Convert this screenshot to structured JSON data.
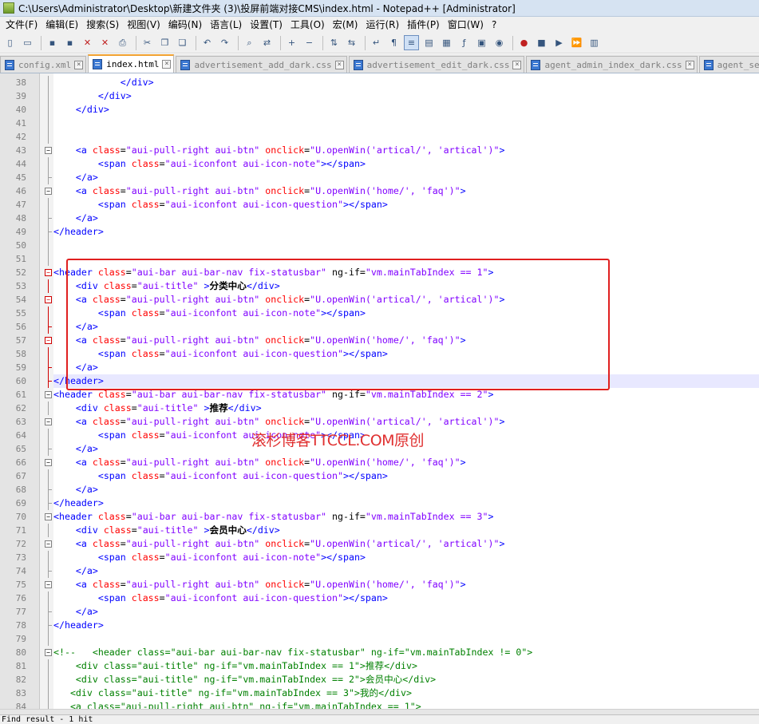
{
  "window": {
    "title": "C:\\Users\\Administrator\\Desktop\\新建文件夹 (3)\\投屏前端对接CMS\\index.html - Notepad++ [Administrator]"
  },
  "menu": [
    "文件(F)",
    "编辑(E)",
    "搜索(S)",
    "视图(V)",
    "编码(N)",
    "语言(L)",
    "设置(T)",
    "工具(O)",
    "宏(M)",
    "运行(R)",
    "插件(P)",
    "窗口(W)",
    "?"
  ],
  "toolbar": {
    "icons": [
      "new-file-icon",
      "open-file-icon",
      "save-icon",
      "save-all-icon",
      "close-icon",
      "close-all-icon",
      "print-icon",
      "cut-icon",
      "copy-icon",
      "paste-icon",
      "undo-icon",
      "redo-icon",
      "find-icon",
      "replace-icon",
      "zoom-in-icon",
      "zoom-out-icon",
      "sync-vertical-icon",
      "sync-horizontal-icon",
      "word-wrap-icon",
      "show-all-chars-icon",
      "indent-guide-icon",
      "user-language-icon",
      "doc-map-icon",
      "function-list-icon",
      "folder-workspace-icon",
      "monitoring-icon",
      "record-macro-icon",
      "stop-record-icon",
      "play-macro-icon",
      "run-macro-multiple-icon",
      "save-macro-icon"
    ],
    "active_icon": "indent-guide-icon"
  },
  "tabs": [
    {
      "label": "config.xml",
      "active": false
    },
    {
      "label": "index.html",
      "active": true
    },
    {
      "label": "advertisement_add_dark.css",
      "active": false
    },
    {
      "label": "advertisement_edit_dark.css",
      "active": false
    },
    {
      "label": "agent_admin_index_dark.css",
      "active": false
    },
    {
      "label": "agent_search.css",
      "active": false
    }
  ],
  "editor": {
    "current_line": 60,
    "lines": [
      {
        "n": 38,
        "fold": "line",
        "t": [
          [
            "tag",
            "            </div>"
          ]
        ]
      },
      {
        "n": 39,
        "fold": "line",
        "t": [
          [
            "tag",
            "        </div>"
          ]
        ]
      },
      {
        "n": 40,
        "fold": "line",
        "t": [
          [
            "tag",
            "    </div>"
          ]
        ]
      },
      {
        "n": 41,
        "fold": "line",
        "t": []
      },
      {
        "n": 42,
        "fold": "line",
        "t": []
      },
      {
        "n": 43,
        "fold": "box",
        "t": [
          [
            "plain",
            "    "
          ],
          [
            "tag",
            "<a "
          ],
          [
            "attr",
            "class"
          ],
          [
            "op",
            "="
          ],
          [
            "str",
            "\"aui-pull-right aui-btn\""
          ],
          [
            "plain",
            " "
          ],
          [
            "attr",
            "onclick"
          ],
          [
            "op",
            "="
          ],
          [
            "str",
            "\"U.openWin('artical/', 'artical')\""
          ],
          [
            "tag",
            ">"
          ]
        ]
      },
      {
        "n": 44,
        "fold": "line",
        "t": [
          [
            "plain",
            "        "
          ],
          [
            "tag",
            "<span "
          ],
          [
            "attr",
            "class"
          ],
          [
            "op",
            "="
          ],
          [
            "str",
            "\"aui-iconfont aui-icon-note\""
          ],
          [
            "tag",
            "></span>"
          ]
        ]
      },
      {
        "n": 45,
        "fold": "end",
        "t": [
          [
            "plain",
            "    "
          ],
          [
            "tag",
            "</a>"
          ]
        ]
      },
      {
        "n": 46,
        "fold": "box",
        "t": [
          [
            "plain",
            "    "
          ],
          [
            "tag",
            "<a "
          ],
          [
            "attr",
            "class"
          ],
          [
            "op",
            "="
          ],
          [
            "str",
            "\"aui-pull-right aui-btn\""
          ],
          [
            "plain",
            " "
          ],
          [
            "attr",
            "onclick"
          ],
          [
            "op",
            "="
          ],
          [
            "str",
            "\"U.openWin('home/', 'faq')\""
          ],
          [
            "tag",
            ">"
          ]
        ]
      },
      {
        "n": 47,
        "fold": "line",
        "t": [
          [
            "plain",
            "        "
          ],
          [
            "tag",
            "<span "
          ],
          [
            "attr",
            "class"
          ],
          [
            "op",
            "="
          ],
          [
            "str",
            "\"aui-iconfont aui-icon-question\""
          ],
          [
            "tag",
            "></span>"
          ]
        ]
      },
      {
        "n": 48,
        "fold": "end",
        "t": [
          [
            "plain",
            "    "
          ],
          [
            "tag",
            "</a>"
          ]
        ]
      },
      {
        "n": 49,
        "fold": "end",
        "t": [
          [
            "tag",
            "</header>"
          ]
        ]
      },
      {
        "n": 50,
        "fold": "line",
        "t": []
      },
      {
        "n": 51,
        "fold": "line",
        "t": []
      },
      {
        "n": 52,
        "fold": "boxred",
        "t": [
          [
            "tag",
            "<header "
          ],
          [
            "attr",
            "class"
          ],
          [
            "op",
            "="
          ],
          [
            "str",
            "\"aui-bar aui-bar-nav fix-statusbar\""
          ],
          [
            "plain",
            " ng-if="
          ],
          [
            "str",
            "\"vm.mainTabIndex == 1\""
          ],
          [
            "tag",
            ">"
          ]
        ]
      },
      {
        "n": 53,
        "fold": "linered",
        "t": [
          [
            "plain",
            "    "
          ],
          [
            "tag",
            "<div "
          ],
          [
            "attr",
            "class"
          ],
          [
            "op",
            "="
          ],
          [
            "str",
            "\"aui-title\""
          ],
          [
            "plain",
            " "
          ],
          [
            "tag",
            ">"
          ],
          [
            "bold",
            "分类中心"
          ],
          [
            "tag",
            "</div>"
          ]
        ]
      },
      {
        "n": 54,
        "fold": "boxred",
        "t": [
          [
            "plain",
            "    "
          ],
          [
            "tag",
            "<a "
          ],
          [
            "attr",
            "class"
          ],
          [
            "op",
            "="
          ],
          [
            "str",
            "\"aui-pull-right aui-btn\""
          ],
          [
            "plain",
            " "
          ],
          [
            "attr",
            "onclick"
          ],
          [
            "op",
            "="
          ],
          [
            "str",
            "\"U.openWin('artical/', 'artical')\""
          ],
          [
            "tag",
            ">"
          ]
        ]
      },
      {
        "n": 55,
        "fold": "linered",
        "t": [
          [
            "plain",
            "        "
          ],
          [
            "tag",
            "<span "
          ],
          [
            "attr",
            "class"
          ],
          [
            "op",
            "="
          ],
          [
            "str",
            "\"aui-iconfont aui-icon-note\""
          ],
          [
            "tag",
            "></span>"
          ]
        ]
      },
      {
        "n": 56,
        "fold": "endred",
        "t": [
          [
            "plain",
            "    "
          ],
          [
            "tag",
            "</a>"
          ]
        ]
      },
      {
        "n": 57,
        "fold": "boxred",
        "t": [
          [
            "plain",
            "    "
          ],
          [
            "tag",
            "<a "
          ],
          [
            "attr",
            "class"
          ],
          [
            "op",
            "="
          ],
          [
            "str",
            "\"aui-pull-right aui-btn\""
          ],
          [
            "plain",
            " "
          ],
          [
            "attr",
            "onclick"
          ],
          [
            "op",
            "="
          ],
          [
            "str",
            "\"U.openWin('home/', 'faq')\""
          ],
          [
            "tag",
            ">"
          ]
        ]
      },
      {
        "n": 58,
        "fold": "linered",
        "t": [
          [
            "plain",
            "        "
          ],
          [
            "tag",
            "<span "
          ],
          [
            "attr",
            "class"
          ],
          [
            "op",
            "="
          ],
          [
            "str",
            "\"aui-iconfont aui-icon-question\""
          ],
          [
            "tag",
            "></span>"
          ]
        ]
      },
      {
        "n": 59,
        "fold": "endred",
        "t": [
          [
            "plain",
            "    "
          ],
          [
            "tag",
            "</a>"
          ]
        ]
      },
      {
        "n": 60,
        "fold": "endred",
        "t": [
          [
            "tag",
            "</header>"
          ]
        ]
      },
      {
        "n": 61,
        "fold": "box",
        "t": [
          [
            "tag",
            "<header "
          ],
          [
            "attr",
            "class"
          ],
          [
            "op",
            "="
          ],
          [
            "str",
            "\"aui-bar aui-bar-nav fix-statusbar\""
          ],
          [
            "plain",
            " ng-if="
          ],
          [
            "str",
            "\"vm.mainTabIndex == 2\""
          ],
          [
            "tag",
            ">"
          ]
        ]
      },
      {
        "n": 62,
        "fold": "line",
        "t": [
          [
            "plain",
            "    "
          ],
          [
            "tag",
            "<div "
          ],
          [
            "attr",
            "class"
          ],
          [
            "op",
            "="
          ],
          [
            "str",
            "\"aui-title\""
          ],
          [
            "plain",
            " "
          ],
          [
            "tag",
            ">"
          ],
          [
            "bold",
            "推荐"
          ],
          [
            "tag",
            "</div>"
          ]
        ]
      },
      {
        "n": 63,
        "fold": "box",
        "t": [
          [
            "plain",
            "    "
          ],
          [
            "tag",
            "<a "
          ],
          [
            "attr",
            "class"
          ],
          [
            "op",
            "="
          ],
          [
            "str",
            "\"aui-pull-right aui-btn\""
          ],
          [
            "plain",
            " "
          ],
          [
            "attr",
            "onclick"
          ],
          [
            "op",
            "="
          ],
          [
            "str",
            "\"U.openWin('artical/', 'artical')\""
          ],
          [
            "tag",
            ">"
          ]
        ]
      },
      {
        "n": 64,
        "fold": "line",
        "t": [
          [
            "plain",
            "        "
          ],
          [
            "tag",
            "<span "
          ],
          [
            "attr",
            "class"
          ],
          [
            "op",
            "="
          ],
          [
            "str",
            "\"aui-iconfont aui-icon-note\""
          ],
          [
            "tag",
            "></span>"
          ]
        ]
      },
      {
        "n": 65,
        "fold": "end",
        "t": [
          [
            "plain",
            "    "
          ],
          [
            "tag",
            "</a>"
          ]
        ]
      },
      {
        "n": 66,
        "fold": "box",
        "t": [
          [
            "plain",
            "    "
          ],
          [
            "tag",
            "<a "
          ],
          [
            "attr",
            "class"
          ],
          [
            "op",
            "="
          ],
          [
            "str",
            "\"aui-pull-right aui-btn\""
          ],
          [
            "plain",
            " "
          ],
          [
            "attr",
            "onclick"
          ],
          [
            "op",
            "="
          ],
          [
            "str",
            "\"U.openWin('home/', 'faq')\""
          ],
          [
            "tag",
            ">"
          ]
        ]
      },
      {
        "n": 67,
        "fold": "line",
        "t": [
          [
            "plain",
            "        "
          ],
          [
            "tag",
            "<span "
          ],
          [
            "attr",
            "class"
          ],
          [
            "op",
            "="
          ],
          [
            "str",
            "\"aui-iconfont aui-icon-question\""
          ],
          [
            "tag",
            "></span>"
          ]
        ]
      },
      {
        "n": 68,
        "fold": "end",
        "t": [
          [
            "plain",
            "    "
          ],
          [
            "tag",
            "</a>"
          ]
        ]
      },
      {
        "n": 69,
        "fold": "end",
        "t": [
          [
            "tag",
            "</header>"
          ]
        ]
      },
      {
        "n": 70,
        "fold": "box",
        "t": [
          [
            "tag",
            "<header "
          ],
          [
            "attr",
            "class"
          ],
          [
            "op",
            "="
          ],
          [
            "str",
            "\"aui-bar aui-bar-nav fix-statusbar\""
          ],
          [
            "plain",
            " ng-if="
          ],
          [
            "str",
            "\"vm.mainTabIndex == 3\""
          ],
          [
            "tag",
            ">"
          ]
        ]
      },
      {
        "n": 71,
        "fold": "line",
        "t": [
          [
            "plain",
            "    "
          ],
          [
            "tag",
            "<div "
          ],
          [
            "attr",
            "class"
          ],
          [
            "op",
            "="
          ],
          [
            "str",
            "\"aui-title\""
          ],
          [
            "plain",
            " "
          ],
          [
            "tag",
            ">"
          ],
          [
            "bold",
            "会员中心"
          ],
          [
            "tag",
            "</div>"
          ]
        ]
      },
      {
        "n": 72,
        "fold": "box",
        "t": [
          [
            "plain",
            "    "
          ],
          [
            "tag",
            "<a "
          ],
          [
            "attr",
            "class"
          ],
          [
            "op",
            "="
          ],
          [
            "str",
            "\"aui-pull-right aui-btn\""
          ],
          [
            "plain",
            " "
          ],
          [
            "attr",
            "onclick"
          ],
          [
            "op",
            "="
          ],
          [
            "str",
            "\"U.openWin('artical/', 'artical')\""
          ],
          [
            "tag",
            ">"
          ]
        ]
      },
      {
        "n": 73,
        "fold": "line",
        "t": [
          [
            "plain",
            "        "
          ],
          [
            "tag",
            "<span "
          ],
          [
            "attr",
            "class"
          ],
          [
            "op",
            "="
          ],
          [
            "str",
            "\"aui-iconfont aui-icon-note\""
          ],
          [
            "tag",
            "></span>"
          ]
        ]
      },
      {
        "n": 74,
        "fold": "end",
        "t": [
          [
            "plain",
            "    "
          ],
          [
            "tag",
            "</a>"
          ]
        ]
      },
      {
        "n": 75,
        "fold": "box",
        "t": [
          [
            "plain",
            "    "
          ],
          [
            "tag",
            "<a "
          ],
          [
            "attr",
            "class"
          ],
          [
            "op",
            "="
          ],
          [
            "str",
            "\"aui-pull-right aui-btn\""
          ],
          [
            "plain",
            " "
          ],
          [
            "attr",
            "onclick"
          ],
          [
            "op",
            "="
          ],
          [
            "str",
            "\"U.openWin('home/', 'faq')\""
          ],
          [
            "tag",
            ">"
          ]
        ]
      },
      {
        "n": 76,
        "fold": "line",
        "t": [
          [
            "plain",
            "        "
          ],
          [
            "tag",
            "<span "
          ],
          [
            "attr",
            "class"
          ],
          [
            "op",
            "="
          ],
          [
            "str",
            "\"aui-iconfont aui-icon-question\""
          ],
          [
            "tag",
            "></span>"
          ]
        ]
      },
      {
        "n": 77,
        "fold": "end",
        "t": [
          [
            "plain",
            "    "
          ],
          [
            "tag",
            "</a>"
          ]
        ]
      },
      {
        "n": 78,
        "fold": "end",
        "t": [
          [
            "tag",
            "</header>"
          ]
        ]
      },
      {
        "n": 79,
        "fold": "line",
        "t": []
      },
      {
        "n": 80,
        "fold": "box",
        "t": [
          [
            "comment",
            "<!--   <header class=\"aui-bar aui-bar-nav fix-statusbar\" ng-if=\"vm.mainTabIndex != 0\">"
          ]
        ]
      },
      {
        "n": 81,
        "fold": "line",
        "t": [
          [
            "comment",
            "    <div class=\"aui-title\" ng-if=\"vm.mainTabIndex == 1\">推荐</div>"
          ]
        ]
      },
      {
        "n": 82,
        "fold": "line",
        "t": [
          [
            "comment",
            "    <div class=\"aui-title\" ng-if=\"vm.mainTabIndex == 2\">会员中心</div>"
          ]
        ]
      },
      {
        "n": 83,
        "fold": "line",
        "t": [
          [
            "comment",
            "   <div class=\"aui-title\" ng-if=\"vm.mainTabIndex == 3\">我的</div>"
          ]
        ]
      },
      {
        "n": 84,
        "fold": "line",
        "t": [
          [
            "comment",
            "   <a class=\"aui-pull-right aui-btn\" ng-if=\"vm.mainTabIndex == 1\">"
          ]
        ]
      }
    ]
  },
  "watermark": "滚杉博客TTCCL.COM原创",
  "status": {
    "find_result": "Find result - 1 hit"
  },
  "colors": {
    "highlight_box": "#e02020",
    "tag": "#0000ff",
    "attribute": "#ff0000",
    "string": "#8000ff",
    "comment": "#008000"
  }
}
